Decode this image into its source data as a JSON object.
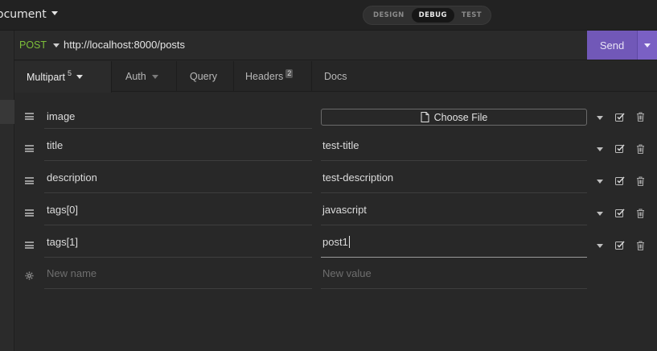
{
  "workspace": {
    "title": "ocument"
  },
  "mode_switch": {
    "items": [
      "DESIGN",
      "DEBUG",
      "TEST"
    ],
    "active": "DEBUG"
  },
  "request": {
    "method": "POST",
    "url": "http://localhost:8000/posts",
    "send_label": "Send"
  },
  "tabs": [
    {
      "label": "Multipart",
      "badge": "5"
    },
    {
      "label": "Auth"
    },
    {
      "label": "Query"
    },
    {
      "label": "Headers",
      "badge": "2"
    },
    {
      "label": "Docs"
    }
  ],
  "params": [
    {
      "name": "image",
      "value": "",
      "type": "file",
      "file_button_label": "Choose File"
    },
    {
      "name": "title",
      "value": "test-title",
      "type": "text"
    },
    {
      "name": "description",
      "value": "test-description",
      "type": "text"
    },
    {
      "name": "tags[0]",
      "value": "javascript",
      "type": "text"
    },
    {
      "name": "tags[1]",
      "value": "post1",
      "type": "text"
    }
  ],
  "new_row": {
    "name_placeholder": "New name",
    "value_placeholder": "New value"
  },
  "colors": {
    "method_post": "#7dbf3a",
    "send_button": "#7158b8",
    "background": "#282828"
  },
  "icons": [
    "chevron-down-icon",
    "drag-handle-icon",
    "file-icon",
    "checkbox-icon",
    "trash-icon",
    "gear-icon"
  ]
}
